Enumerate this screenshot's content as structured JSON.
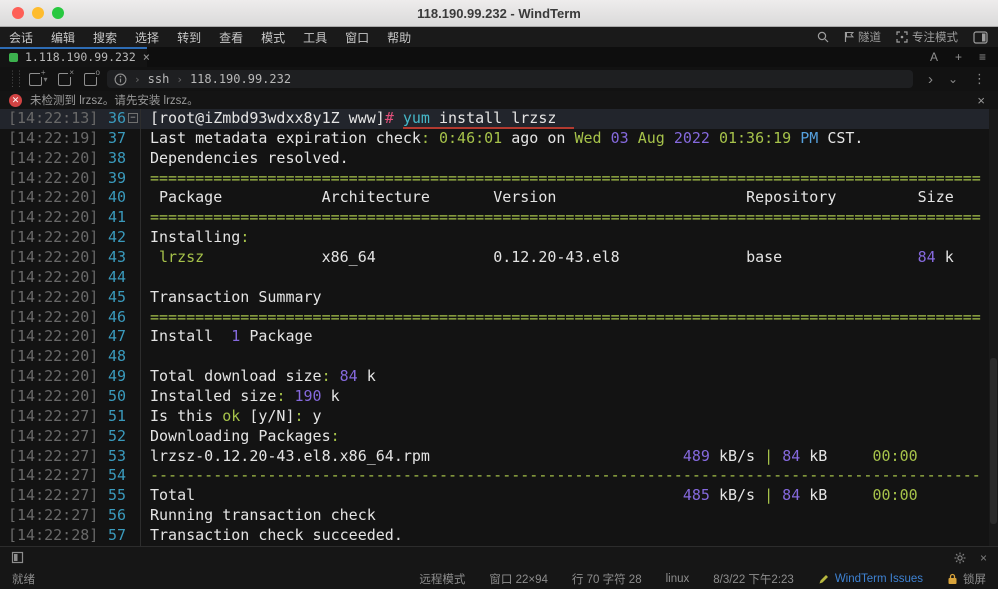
{
  "titlebar": {
    "title": "118.190.99.232 - WindTerm"
  },
  "menubar": {
    "items": [
      "会话",
      "编辑",
      "搜索",
      "选择",
      "转到",
      "查看",
      "模式",
      "工具",
      "窗口",
      "帮助"
    ],
    "tunnel_label": "隧道",
    "focus_label": "专注模式"
  },
  "tabbar": {
    "tab_label": "1.118.190.99.232",
    "close_glyph": "×",
    "font_button": "A",
    "new_button": "+",
    "list_button": "≡"
  },
  "toolbar": {
    "breadcrumb_protocol": "ssh",
    "breadcrumb_host": "118.190.99.232",
    "run_glyph": "›",
    "down_glyph": "⌄",
    "more_glyph": "⋮"
  },
  "notification": {
    "message": "未检测到 lrzsz。请先安装 lrzsz。",
    "close_glyph": "×",
    "error_glyph": "✕"
  },
  "colors": {
    "w": "#e4e4e4",
    "g": "#a6c24a",
    "p": "#8569dd",
    "c": "#45b8c9",
    "r": "#e0507a",
    "b": "#55a0dd"
  },
  "terminal": {
    "lines": [
      {
        "ts": "14:22:13",
        "no": "36",
        "fold": true,
        "hl": true,
        "seg": [
          [
            "[root@iZmbd93wdxx8y1Z www]",
            "w"
          ],
          [
            "#",
            "r"
          ],
          [
            " ",
            "w"
          ],
          [
            "yum",
            "c",
            1
          ],
          [
            " install lrzsz",
            "w",
            1
          ],
          [
            "  ",
            "w",
            1
          ]
        ]
      },
      {
        "ts": "14:22:19",
        "no": "37",
        "seg": [
          [
            "Last metadata expiration check",
            "w"
          ],
          [
            ":",
            "g"
          ],
          [
            " ",
            "w"
          ],
          [
            "0:46:01",
            "g"
          ],
          [
            " ago on ",
            "w"
          ],
          [
            "Wed",
            "g"
          ],
          [
            " ",
            "w"
          ],
          [
            "03",
            "p"
          ],
          [
            " ",
            "w"
          ],
          [
            "Aug",
            "g"
          ],
          [
            " ",
            "w"
          ],
          [
            "2022",
            "p"
          ],
          [
            " ",
            "w"
          ],
          [
            "01:36:19",
            "g"
          ],
          [
            " ",
            "w"
          ],
          [
            "PM",
            "b"
          ],
          [
            " CST.",
            "w"
          ]
        ]
      },
      {
        "ts": "14:22:20",
        "no": "38",
        "seg": [
          [
            "Dependencies resolved.",
            "w"
          ]
        ]
      },
      {
        "ts": "14:22:20",
        "no": "39",
        "seg": [
          [
            "=",
            "g",
            0,
            92
          ]
        ]
      },
      {
        "ts": "14:22:20",
        "no": "40",
        "seg": [
          [
            " Package",
            "w"
          ],
          [
            " ",
            "w",
            0,
            11
          ],
          [
            "Architecture",
            "w"
          ],
          [
            " ",
            "w",
            0,
            7
          ],
          [
            "Version",
            "w"
          ],
          [
            " ",
            "w",
            0,
            21
          ],
          [
            "Repository",
            "w"
          ],
          [
            " ",
            "w",
            0,
            9
          ],
          [
            "Size",
            "w"
          ]
        ]
      },
      {
        "ts": "14:22:20",
        "no": "41",
        "seg": [
          [
            "=",
            "g",
            0,
            92
          ]
        ]
      },
      {
        "ts": "14:22:20",
        "no": "42",
        "seg": [
          [
            "Installing",
            "w"
          ],
          [
            ":",
            "g"
          ]
        ]
      },
      {
        "ts": "14:22:20",
        "no": "43",
        "seg": [
          [
            " lrzsz",
            "g"
          ],
          [
            " ",
            "w",
            0,
            13
          ],
          [
            "x86_64",
            "w"
          ],
          [
            " ",
            "w",
            0,
            13
          ],
          [
            "0.12.20-43.el8",
            "w"
          ],
          [
            " ",
            "w",
            0,
            14
          ],
          [
            "base",
            "w"
          ],
          [
            " ",
            "w",
            0,
            15
          ],
          [
            "84",
            "p"
          ],
          [
            " k",
            "w"
          ]
        ]
      },
      {
        "ts": "14:22:20",
        "no": "44",
        "seg": []
      },
      {
        "ts": "14:22:20",
        "no": "45",
        "seg": [
          [
            "Transaction Summary",
            "w"
          ]
        ]
      },
      {
        "ts": "14:22:20",
        "no": "46",
        "seg": [
          [
            "=",
            "g",
            0,
            92
          ]
        ]
      },
      {
        "ts": "14:22:20",
        "no": "47",
        "seg": [
          [
            "Install  ",
            "w"
          ],
          [
            "1",
            "p"
          ],
          [
            " Package",
            "w"
          ]
        ]
      },
      {
        "ts": "14:22:20",
        "no": "48",
        "seg": []
      },
      {
        "ts": "14:22:20",
        "no": "49",
        "seg": [
          [
            "Total download size",
            "w"
          ],
          [
            ":",
            "g"
          ],
          [
            " ",
            "w"
          ],
          [
            "84",
            "p"
          ],
          [
            " k",
            "w"
          ]
        ]
      },
      {
        "ts": "14:22:20",
        "no": "50",
        "seg": [
          [
            "Installed size",
            "w"
          ],
          [
            ":",
            "g"
          ],
          [
            " ",
            "w"
          ],
          [
            "190",
            "p"
          ],
          [
            " k",
            "w"
          ]
        ]
      },
      {
        "ts": "14:22:27",
        "no": "51",
        "seg": [
          [
            "Is this ",
            "w"
          ],
          [
            "ok",
            "g"
          ],
          [
            " [y/N]",
            "w"
          ],
          [
            ":",
            "g"
          ],
          [
            " y",
            "w"
          ]
        ]
      },
      {
        "ts": "14:22:27",
        "no": "52",
        "seg": [
          [
            "Downloading Packages",
            "w"
          ],
          [
            ":",
            "g"
          ]
        ]
      },
      {
        "ts": "14:22:27",
        "no": "53",
        "seg": [
          [
            "lrzsz-0.12.20-43.el8.x86_64.rpm",
            "w"
          ],
          [
            " ",
            "w",
            0,
            28
          ],
          [
            "489",
            "p"
          ],
          [
            " kB/s ",
            "w"
          ],
          [
            "|",
            "g"
          ],
          [
            " ",
            "w"
          ],
          [
            "84",
            "p"
          ],
          [
            " kB",
            "w"
          ],
          [
            " ",
            "w",
            0,
            5
          ],
          [
            "00:00",
            "g"
          ]
        ]
      },
      {
        "ts": "14:22:27",
        "no": "54",
        "seg": [
          [
            "-",
            "g",
            0,
            92
          ]
        ]
      },
      {
        "ts": "14:22:27",
        "no": "55",
        "seg": [
          [
            "Total",
            "w"
          ],
          [
            " ",
            "w",
            0,
            54
          ],
          [
            "485",
            "p"
          ],
          [
            " kB/s ",
            "w"
          ],
          [
            "|",
            "g"
          ],
          [
            " ",
            "w"
          ],
          [
            "84",
            "p"
          ],
          [
            " kB",
            "w"
          ],
          [
            " ",
            "w",
            0,
            5
          ],
          [
            "00:00",
            "g"
          ]
        ]
      },
      {
        "ts": "14:22:27",
        "no": "56",
        "seg": [
          [
            "Running transaction check",
            "w"
          ]
        ]
      },
      {
        "ts": "14:22:28",
        "no": "57",
        "seg": [
          [
            "Transaction check succeeded.",
            "w"
          ]
        ]
      }
    ]
  },
  "statusbar": {
    "ready": "就绪",
    "remote_mode": "远程模式",
    "window_size": "窗口 22×94",
    "cursor_position": "行 70 字符 28",
    "os": "linux",
    "datetime": "8/3/22 下午2:23",
    "issues_link": "WindTerm Issues",
    "lock_label": "锁屏"
  }
}
